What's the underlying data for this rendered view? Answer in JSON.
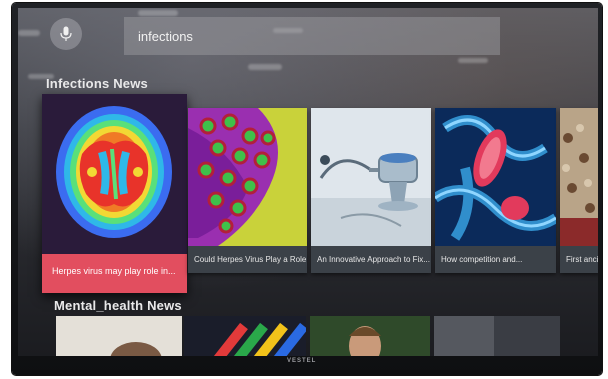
{
  "search": {
    "query": "infections",
    "mic_icon": "mic-icon"
  },
  "rows": [
    {
      "title": "Infections News",
      "cards": [
        {
          "caption": "Herpes virus may play role in...",
          "art": "brain-scan",
          "focused": true
        },
        {
          "caption": "Could Herpes Virus Play a Role...",
          "art": "virus-cells"
        },
        {
          "caption": "An Innovative Approach to Fix...",
          "art": "stethoscope"
        },
        {
          "caption": "How competition and...",
          "art": "bacteria"
        },
        {
          "caption": "First ancie",
          "art": "crowd-photo"
        }
      ]
    },
    {
      "title": "Mental_health News",
      "cards": [
        {
          "art": "person-photo"
        },
        {
          "art": "colorful-stripes"
        },
        {
          "art": "man-portrait"
        },
        {
          "art": "abstract-dark"
        }
      ]
    }
  ],
  "tv_brand": "VESTEL",
  "colors": {
    "focus_caption": "#e24e5f",
    "caption_bg": "#3b4148"
  }
}
